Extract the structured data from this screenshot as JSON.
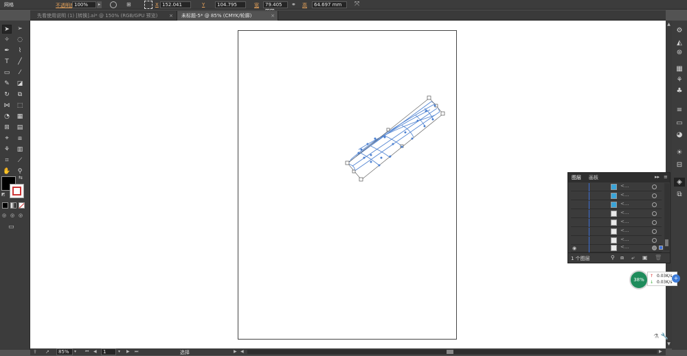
{
  "control_bar": {
    "title": "网格",
    "opacity_label": "不透明度",
    "opacity_value": "100%",
    "x_label": "X",
    "x_value": "152.041",
    "y_label": "Y",
    "y_value": "104.795",
    "w_label": "宽",
    "w_value": "79.405 mm",
    "h_label": "高",
    "h_value": "64.697 mm"
  },
  "tabs": [
    {
      "label": "先看使用说明 (1) [转换].ai* @ 150% (RGB/GPU 预览)",
      "close": "×",
      "active": false
    },
    {
      "label": "未标题-5* @ 85% (CMYK/轮廓)",
      "close": "×",
      "active": true
    }
  ],
  "layers_panel": {
    "tab_layers": "图层",
    "tab_artboards": "画板",
    "row_name": "<...",
    "footer_count": "1 个图层"
  },
  "status": {
    "zoom": "85%",
    "page": "1",
    "tool_status": "选择"
  },
  "network_widget": {
    "percent": "38%",
    "upload": "0.03K/s",
    "download": "0.03K/s"
  },
  "colors": {
    "selection_blue": "#4a7fd0",
    "accent_orange": "#e8a35a",
    "panel_dark": "#3c3c3c"
  }
}
